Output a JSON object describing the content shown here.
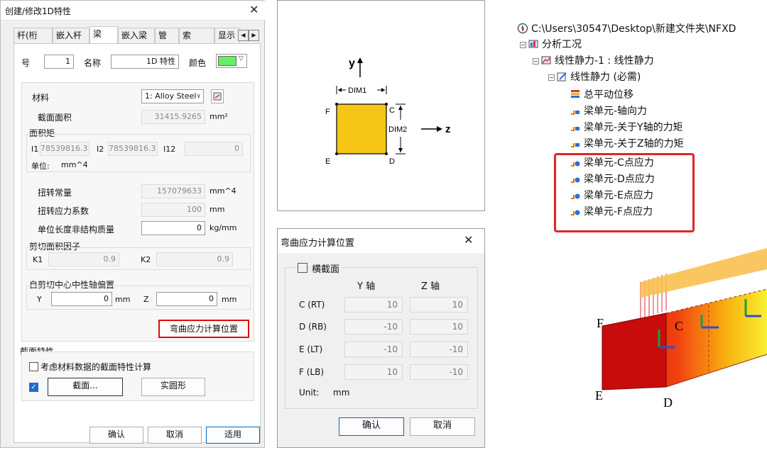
{
  "dialog1": {
    "title": "创建/修改1D特性",
    "tabs": [
      "杆(桁架)",
      "嵌入杆",
      "梁",
      "嵌入梁",
      "管",
      "索",
      "显示"
    ],
    "active_tab": "梁",
    "number_label": "号",
    "number_value": "1",
    "name_label": "名称",
    "name_value": "1D 特性",
    "color_label": "颜色",
    "color_value": "#66ee66",
    "material_label": "材料",
    "material_value": "1: Alloy Steel",
    "area_label": "截面面积",
    "area_value": "31415.9265",
    "area_unit": "mm²",
    "moment_group_label": "面积矩",
    "i1_label": "I1",
    "i1_value": "78539816.3",
    "i2_label": "I2",
    "i2_value": "78539816.3",
    "i12_label": "I12",
    "i12_value": "0",
    "unit_label": "单位:",
    "unit_value": "mm^4",
    "torsion_label": "扭转常量",
    "torsion_value": "157079633",
    "torsion_unit": "mm^4",
    "torsion_stress_label": "扭转应力系数",
    "torsion_stress_value": "100",
    "torsion_stress_unit": "mm",
    "nonstruct_mass_label": "单位长度非结构质量",
    "nonstruct_mass_value": "0",
    "nonstruct_mass_unit": "kg/mm",
    "shear_group_label": "剪切面积因子",
    "k1_label": "K1",
    "k1_value": "0.9",
    "k2_label": "K2",
    "k2_value": "0.9",
    "offset_group_label": "自剪切中心中性轴偏置",
    "y_label": "Y",
    "y_value": "0",
    "y_unit": "mm",
    "z_label": "Z",
    "z_value": "0",
    "z_unit": "mm",
    "bending_button": "弯曲应力计算位置",
    "section_group_label": "截面特性",
    "consider_material_label": "考虑材料数据的截面特性计算",
    "consider_material_checked": false,
    "section_checked": true,
    "section_button": "截面...",
    "solid_circle_button": "实圆形",
    "ok_button": "确认",
    "cancel_button": "取消",
    "apply_button": "适用"
  },
  "diagram": {
    "y_axis": "y",
    "z_axis": "z",
    "dim1": "DIM1",
    "dim2": "DIM2",
    "c": "C",
    "d": "D",
    "e": "E",
    "f": "F",
    "fill_color": "#f5c518"
  },
  "dialog2": {
    "title": "弯曲应力计算位置",
    "cross_section_label": "横截面",
    "cross_section_checked": false,
    "y_axis_header": "Y 轴",
    "z_axis_header": "Z 轴",
    "rows": [
      {
        "label": "C (RT)",
        "y": "10",
        "z": "10"
      },
      {
        "label": "D (RB)",
        "y": "-10",
        "z": "10"
      },
      {
        "label": "E (LT)",
        "y": "-10",
        "z": "-10"
      },
      {
        "label": "F (LB)",
        "y": "10",
        "z": "-10"
      }
    ],
    "unit_label": "Unit:",
    "unit_value": "mm",
    "ok_button": "确认",
    "cancel_button": "取消"
  },
  "tree": {
    "root": "C:\\Users\\30547\\Desktop\\新建文件夹\\NFXD",
    "analysis_case": "分析工况",
    "linear_static_1": "线性静力-1 : 线性静力",
    "linear_static_required": "线性静力 (必需)",
    "items": [
      "总平动位移",
      "梁单元-轴向力",
      "梁单元-关于Y轴的力矩",
      "梁单元-关于Z轴的力矩",
      "梁单元-C点应力",
      "梁单元-D点应力",
      "梁单元-E点应力",
      "梁单元-F点应力"
    ]
  },
  "model": {
    "f": "F",
    "c": "C",
    "e": "E",
    "d": "D"
  }
}
